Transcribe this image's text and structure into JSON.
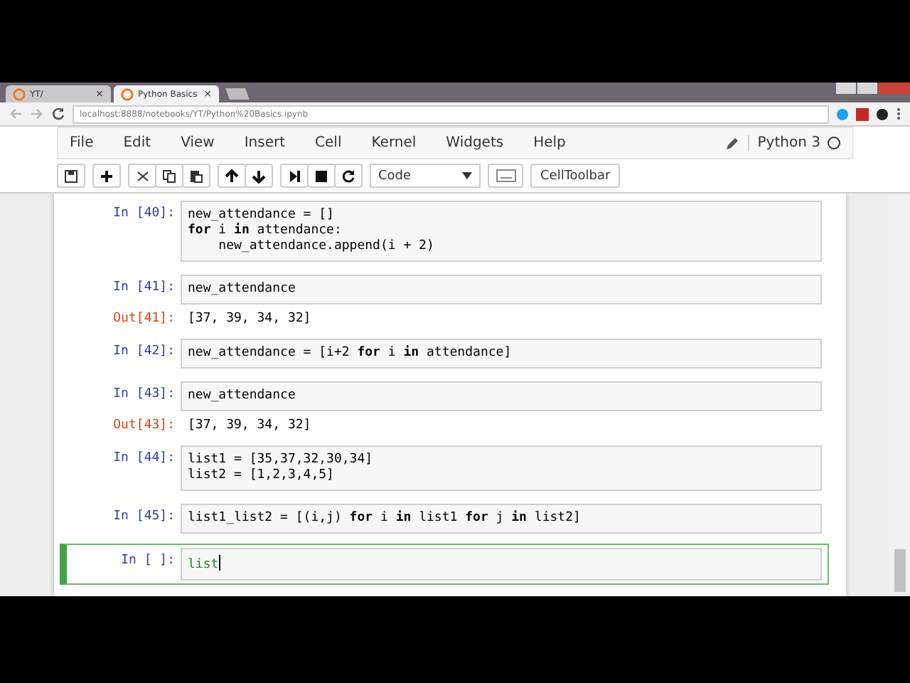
{
  "browser": {
    "tabs": [
      {
        "label": "YT/",
        "selected": false
      },
      {
        "label": "Python Basics",
        "selected": true
      }
    ],
    "close_glyph": "×",
    "url": "localhost:8888/notebooks/YT/Python%20Basics.ipynb"
  },
  "menu": [
    "File",
    "Edit",
    "View",
    "Insert",
    "Cell",
    "Kernel",
    "Widgets",
    "Help"
  ],
  "kernel": {
    "name": "Python 3",
    "busy": false
  },
  "toolbar": {
    "cell_type": "Code",
    "celltoolbar": "CellToolbar"
  },
  "cells": [
    {
      "prompt": "In [40]:",
      "code": [
        "new_attendance = []",
        "**for** i **in** attendance:",
        "    new_attendance.append(i + 2)"
      ],
      "selected": false
    },
    {
      "prompt": "In [41]:",
      "code": [
        "new_attendance"
      ],
      "output_prompt": "Out[41]:",
      "output": "[37, 39, 34, 32]",
      "selected": false
    },
    {
      "prompt": "In [42]:",
      "code": [
        "new_attendance = [i+2 **for** i **in** attendance]"
      ],
      "selected": false
    },
    {
      "prompt": "In [43]:",
      "code": [
        "new_attendance"
      ],
      "output_prompt": "Out[43]:",
      "output": "[37, 39, 34, 32]",
      "selected": false
    },
    {
      "prompt": "In [44]:",
      "code": [
        "list1 = [35,37,32,30,34]",
        "list2 = [1,2,3,4,5]"
      ],
      "selected": false
    },
    {
      "prompt": "In [45]:",
      "code": [
        "list1_list2 = [(i,j) **for** i **in** list1 **for** j **in** list2]"
      ],
      "selected": false
    },
    {
      "prompt": "In [ ]:",
      "code": [
        "list"
      ],
      "selected": true
    }
  ]
}
